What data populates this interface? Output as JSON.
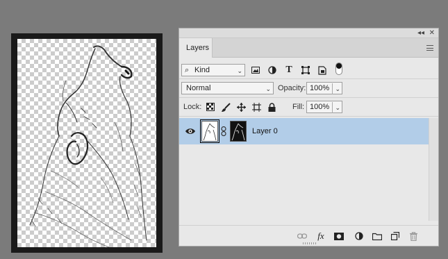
{
  "panel": {
    "collapse_glyph": "◂◂",
    "close_glyph": "✕",
    "tab_label": "Layers",
    "menu_icon": "hamburger-menu-icon"
  },
  "filter": {
    "search_glyph": "⌕",
    "kind_label": "Kind",
    "caret": "⌄",
    "icons": [
      "image-filter-icon",
      "adjustment-filter-icon",
      "type-filter-icon",
      "shape-filter-icon",
      "smart-object-filter-icon",
      "filter-toggle-icon"
    ],
    "type_glyph": "T"
  },
  "blend": {
    "mode": "Normal",
    "opacity_label": "Opacity:",
    "opacity_value": "100%",
    "caret": "⌄"
  },
  "lock": {
    "label": "Lock:",
    "icons": [
      "lock-transparent-pixels-icon",
      "lock-image-pixels-icon",
      "lock-position-icon",
      "lock-artboard-icon",
      "lock-all-icon"
    ],
    "fill_label": "Fill:",
    "fill_value": "100%",
    "caret": "⌄"
  },
  "layers": [
    {
      "name": "Layer 0",
      "visible": true,
      "has_mask": true,
      "selected": true
    }
  ],
  "bottom_icons": [
    "link-layers-icon",
    "fx-icon",
    "add-mask-icon",
    "adjustment-layer-icon",
    "new-group-icon",
    "new-layer-icon",
    "delete-layer-icon"
  ],
  "fx_label": "fx",
  "colors": {
    "background": "#7b7b7b",
    "panel": "#e8e8e8",
    "selection": "#b2cde8",
    "canvas_frame": "#1a1a1a"
  }
}
